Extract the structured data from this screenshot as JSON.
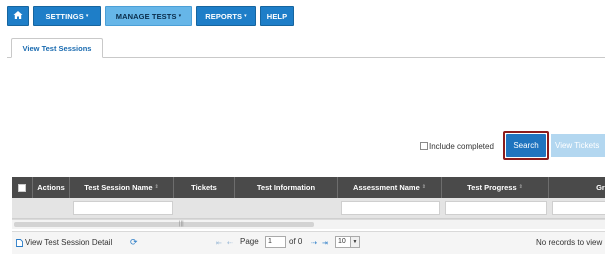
{
  "nav": {
    "items": [
      {
        "label": "",
        "icon": "home-icon"
      },
      {
        "label": "SETTINGS",
        "has_caret": true
      },
      {
        "label": "MANAGE TESTS",
        "has_caret": true,
        "active": true
      },
      {
        "label": "REPORTS",
        "has_caret": true
      },
      {
        "label": "HELP",
        "has_caret": false
      }
    ],
    "caret": "▾"
  },
  "tabs": [
    {
      "label": "View Test Sessions",
      "active": true
    }
  ],
  "filters": {
    "include_completed_label": "Include completed",
    "include_completed_checked": false
  },
  "buttons": {
    "search": "Search",
    "view_tickets": "View Tickets"
  },
  "grid": {
    "columns": [
      "Actions",
      "Test Session Name",
      "Tickets",
      "Test Information",
      "Assessment Name",
      "Test Progress",
      "Gra"
    ]
  },
  "pager": {
    "detail_link": "View Test Session Detail",
    "page_label": "Page",
    "page_value": "1",
    "of_label": "of 0",
    "rows_per_page": "10",
    "status": "No records to view"
  },
  "colors": {
    "nav_blue": "#1e7ec8",
    "nav_active": "#66b6e8",
    "search_blue": "#1f74bf",
    "highlight_outline": "#8c1c1c",
    "grid_header": "#4a4a4a"
  }
}
